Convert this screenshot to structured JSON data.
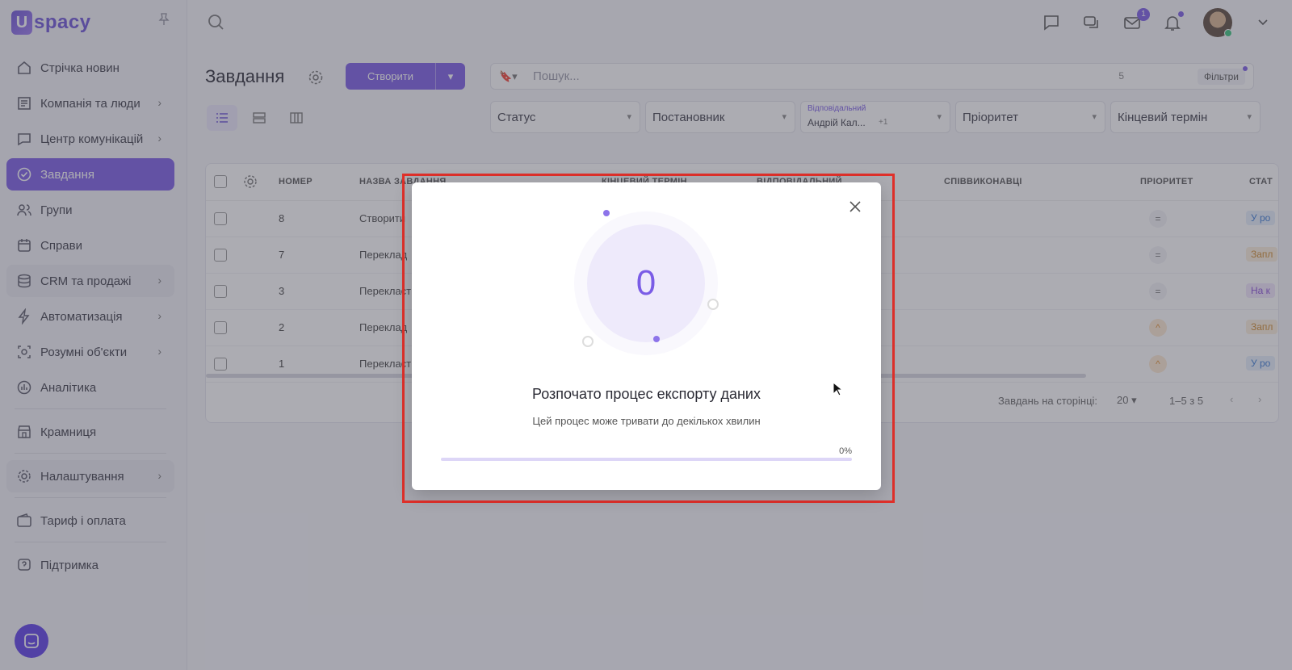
{
  "brand": {
    "logo_letter": "U",
    "logo_text": "spacy"
  },
  "sidebar": {
    "items": [
      {
        "label": "Стрічка новин",
        "icon": "home-icon",
        "chevron": false
      },
      {
        "label": "Компанія та люди",
        "icon": "company-icon",
        "chevron": true
      },
      {
        "label": "Центр комунікацій",
        "icon": "communication-icon",
        "chevron": true
      },
      {
        "label": "Завдання",
        "icon": "check-circle-icon",
        "chevron": false,
        "active": true
      },
      {
        "label": "Групи",
        "icon": "users-icon",
        "chevron": false
      },
      {
        "label": "Справи",
        "icon": "calendar-icon",
        "chevron": false
      },
      {
        "label": "CRM та продажі",
        "icon": "database-icon",
        "chevron": true
      },
      {
        "label": "Автоматизація",
        "icon": "lightning-icon",
        "chevron": true
      },
      {
        "label": "Розумні об'єкти",
        "icon": "smart-object-icon",
        "chevron": true
      },
      {
        "label": "Аналітика",
        "icon": "chart-icon",
        "chevron": false
      },
      {
        "label": "Крамниця",
        "icon": "store-icon",
        "chevron": false
      },
      {
        "label": "Налаштування",
        "icon": "gear-icon",
        "chevron": true
      },
      {
        "label": "Тариф і оплата",
        "icon": "wallet-icon",
        "chevron": false
      },
      {
        "label": "Підтримка",
        "icon": "support-icon",
        "chevron": false
      }
    ]
  },
  "topbar": {
    "mail_badge": "1"
  },
  "page": {
    "title": "Завдання",
    "create_label": "Створити",
    "search_placeholder": "Пошук...",
    "search_count": "5",
    "filters_label": "Фільтри"
  },
  "filters": {
    "status": "Статус",
    "author": "Постановник",
    "responsible_label": "Відповідальний",
    "responsible_value": "Андрій Кал...",
    "responsible_more": "+1",
    "priority": "Пріоритет",
    "deadline": "Кінцевий термін"
  },
  "table": {
    "headers": {
      "number": "НОМЕР",
      "name": "НАЗВА ЗАВДАННЯ",
      "deadline": "КІНЦЕВИЙ ТЕРМІН",
      "responsible": "ВІДПОВІДАЛЬНИЙ",
      "coexecutors": "СПІВВИКОНАВЦІ",
      "priority": "ПРІОРИТЕТ",
      "status": "СТАТ"
    },
    "rows": [
      {
        "num": "8",
        "name": "Створити",
        "prio": "=",
        "status": "У ро",
        "status_color": "#3a7bd5",
        "status_bg": "#e6effb"
      },
      {
        "num": "7",
        "name": "Переклад",
        "prio": "=",
        "status": "Запл",
        "status_color": "#d08a2e",
        "status_bg": "#fbefdc"
      },
      {
        "num": "3",
        "name": "Перекласт",
        "prio": "=",
        "status": "На к",
        "status_color": "#8a4fd8",
        "status_bg": "#f0e6fb"
      },
      {
        "num": "2",
        "name": "Переклад",
        "prio": "^",
        "status": "Запл",
        "status_color": "#d08a2e",
        "status_bg": "#fbefdc"
      },
      {
        "num": "1",
        "name": "Перекласт",
        "prio": "^",
        "status": "У ро",
        "status_color": "#3a7bd5",
        "status_bg": "#e6effb"
      }
    ],
    "footer": {
      "per_page_label": "Завдань на сторінці:",
      "per_page_value": "20",
      "range": "1–5 з 5"
    }
  },
  "modal": {
    "counter": "0",
    "title": "Розпочато процес експорту даних",
    "subtitle": "Цей процес може тривати до декількох хвилин",
    "percent_label": "0%",
    "progress": 0
  },
  "colors": {
    "accent": "#7a5ce6",
    "highlight_frame": "#e0302a"
  }
}
